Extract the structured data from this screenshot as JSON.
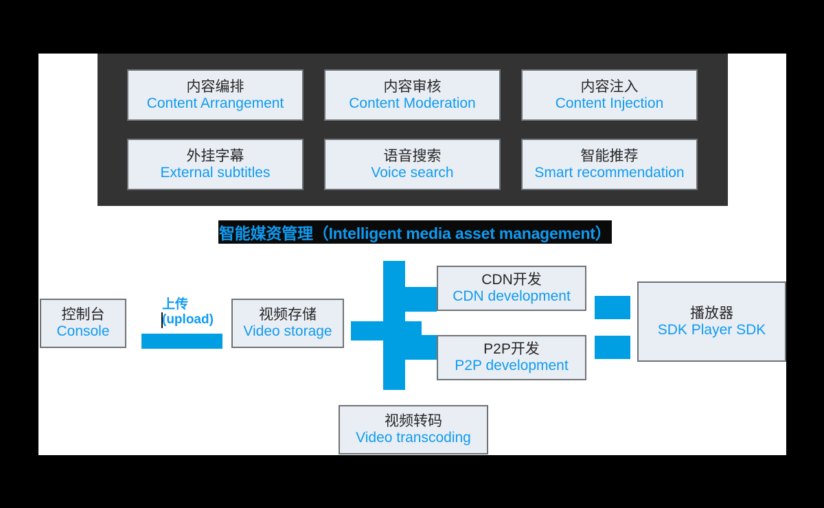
{
  "diagram": {
    "title_banner": {
      "text": "智能媒资管理（Intelligent media asset management）",
      "color": "#0f9bf0",
      "highlight_color": "#0a0a0a"
    },
    "palette": {
      "page_background": "#000000",
      "canvas_background": "#ffffff",
      "band_background": "#333333",
      "box_fill": "#e9eef4",
      "box_border": "#6e7276",
      "accent_blue": "#009fe3",
      "english_text": "#0f9bf0",
      "chinese_text": "#262626"
    },
    "top_section": {
      "features": [
        {
          "cn": "内容编排",
          "en": "Content Arrangement"
        },
        {
          "cn": "内容审核",
          "en": "Content Moderation"
        },
        {
          "cn": "内容注入",
          "en": "Content Injection"
        },
        {
          "cn": "外挂字幕",
          "en": "External subtitles"
        },
        {
          "cn": "语音搜索",
          "en": "Voice search"
        },
        {
          "cn": "智能推荐",
          "en": "Smart recommendation"
        }
      ]
    },
    "flow": {
      "console": {
        "cn": "控制台",
        "en": "Console"
      },
      "upload": {
        "cn": "上传",
        "en": "(upload)"
      },
      "storage": {
        "cn": "视频存储",
        "en": "Video storage"
      },
      "cdn": {
        "cn": "CDN开发",
        "en": "CDN development"
      },
      "p2p": {
        "cn": "P2P开发",
        "en": "P2P development"
      },
      "player": {
        "cn": "播放器",
        "en": "SDK Player SDK"
      },
      "transcoding": {
        "cn": "视频转码",
        "en": "Video transcoding"
      }
    }
  }
}
